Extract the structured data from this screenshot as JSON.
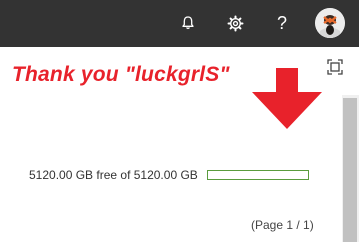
{
  "header": {
    "notifications_icon": "bell-icon",
    "settings_icon": "gear-icon",
    "help_label": "?",
    "avatar_icon": "avatar"
  },
  "annotation": {
    "text": "Thank you \"luckgrlS\"",
    "color": "#e8222b"
  },
  "storage": {
    "text": "5120.00 GB free of 5120.00 GB",
    "used_fraction": 0.0,
    "bar_border_color": "#5a9c3e"
  },
  "pagination": {
    "text": "(Page 1 / 1)"
  },
  "colors": {
    "topbar": "#333333",
    "arrow": "#e8222b"
  }
}
